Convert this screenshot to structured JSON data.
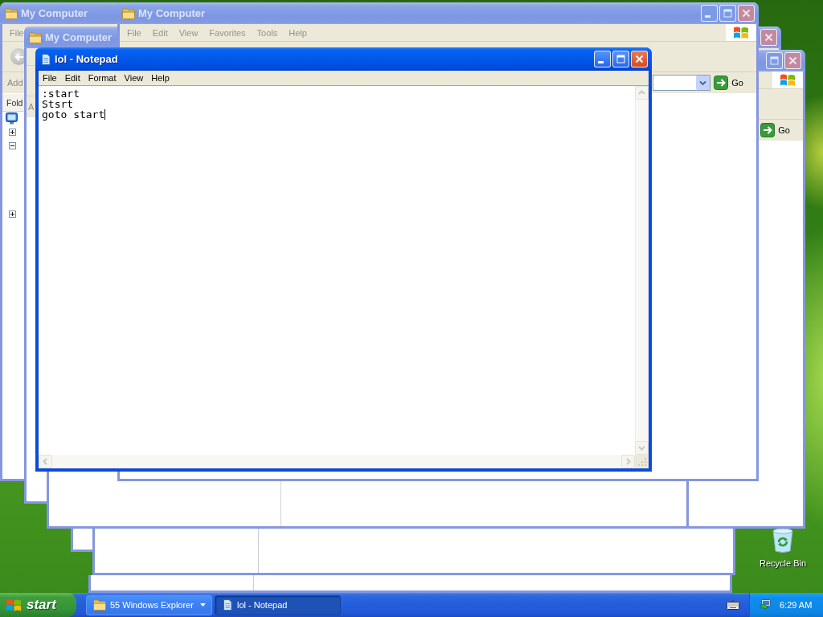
{
  "explorer_windows": [
    {
      "title": "My Computer",
      "active": false,
      "menu": [
        "File"
      ],
      "address_label": "Add",
      "folders_label": "Fold",
      "folder_tree": [
        {
          "children": [
            {
              "expanded": false
            },
            {
              "expanded": true
            },
            {
              "expanded": false
            }
          ]
        }
      ]
    },
    {
      "title": "My Computer",
      "active": false,
      "address_label": "A"
    },
    {
      "active": false,
      "go_label": "Go"
    },
    {
      "title": "My Computer",
      "active": false,
      "menu": [
        "File",
        "Edit",
        "View",
        "Favorites",
        "Tools",
        "Help"
      ],
      "go_label": "Go"
    }
  ],
  "notepad": {
    "title": "lol - Notepad",
    "active": true,
    "menu": [
      "File",
      "Edit",
      "Format",
      "View",
      "Help"
    ],
    "text": ":start\nStsrt\ngoto start"
  },
  "desktop_icons": [
    {
      "label": "Recycle Bin"
    }
  ],
  "taskbar": {
    "start_label": "start",
    "tasks": [
      {
        "kind": "group",
        "label": "55 Windows Explorer",
        "selected": false
      },
      {
        "kind": "window",
        "label": "lol - Notepad",
        "selected": true
      }
    ],
    "clock": "6:29 AM"
  }
}
